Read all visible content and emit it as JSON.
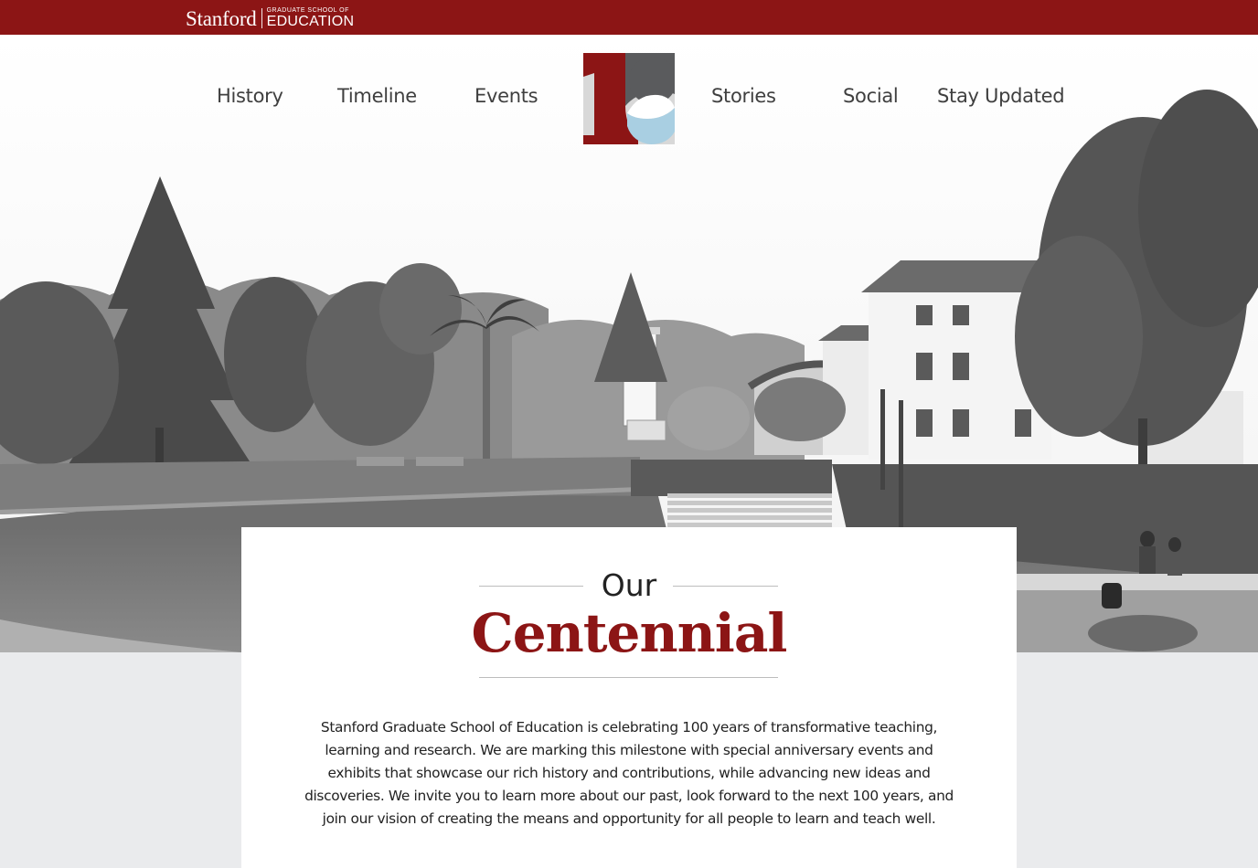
{
  "brand": {
    "university": "Stanford",
    "school_small": "GRADUATE SCHOOL OF",
    "school_big": "EDUCATION"
  },
  "nav": {
    "left": [
      "History",
      "Timeline",
      "Events"
    ],
    "right": [
      "Stories",
      "Social",
      "Stay Updated"
    ]
  },
  "logo": {
    "icon": "centennial-100-logo"
  },
  "hero": {
    "image": "campus-photo-black-and-white"
  },
  "intro": {
    "heading_top": "Our",
    "heading_main": "Centennial",
    "body": "Stanford Graduate School of Education is celebrating 100 years of transformative teaching, learning and research. We are marking this milestone with special anniversary events and exhibits that showcase our rich history and contributions, while advancing new ideas and discoveries. We invite you to learn more about our past, look forward to the next 100 years, and join our vision of creating the means and opportunity for all people to learn and teach well."
  },
  "colors": {
    "cardinal": "#8c1515",
    "light_blue": "#a9cfe2",
    "page_gray": "#eaebed"
  }
}
